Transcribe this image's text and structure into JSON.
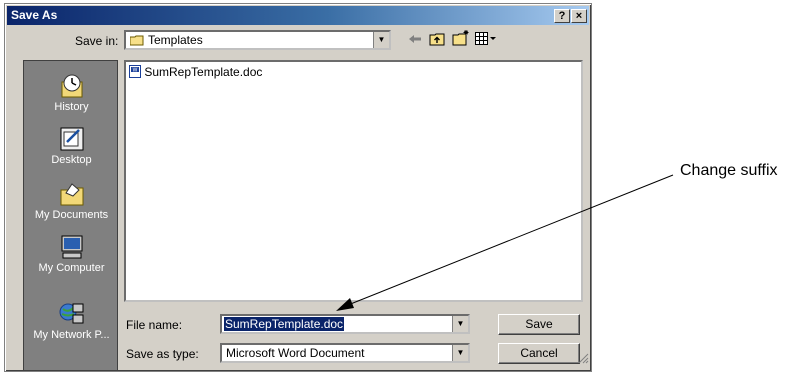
{
  "dialog": {
    "title": "Save As",
    "help_button": "?",
    "close_button": "×"
  },
  "toolbar": {
    "save_in_label": "Save in:",
    "save_in_value": "Templates",
    "back_icon": "back-arrow-icon",
    "up_icon": "up-folder-icon",
    "new_folder_icon": "new-folder-icon",
    "views_icon": "views-menu-icon"
  },
  "places": [
    {
      "label": "History",
      "icon": "history-icon"
    },
    {
      "label": "Desktop",
      "icon": "desktop-icon"
    },
    {
      "label": "My Documents",
      "icon": "my-documents-icon"
    },
    {
      "label": "My Computer",
      "icon": "my-computer-icon"
    },
    {
      "label": "My Network P...",
      "icon": "network-places-icon"
    }
  ],
  "files": [
    {
      "name": "SumRepTemplate.doc",
      "icon": "word-doc-icon"
    }
  ],
  "file_name": {
    "label": "File name:",
    "value": "SumRepTemplate.doc"
  },
  "save_as_type": {
    "label": "Save as type:",
    "value": "Microsoft Word Document"
  },
  "buttons": {
    "save": "Save",
    "cancel": "Cancel"
  },
  "annotation": {
    "text": "Change suffix"
  }
}
